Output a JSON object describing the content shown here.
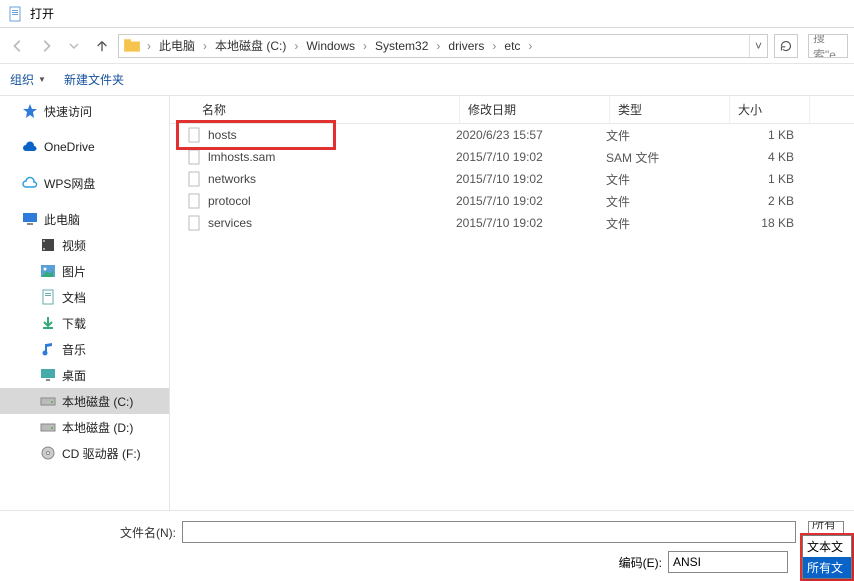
{
  "window": {
    "title": "打开"
  },
  "nav": {
    "breadcrumb": [
      "此电脑",
      "本地磁盘 (C:)",
      "Windows",
      "System32",
      "drivers",
      "etc"
    ],
    "search_placeholder": "搜索\"e"
  },
  "toolbar": {
    "organize": "组织",
    "new_folder": "新建文件夹"
  },
  "sidebar": {
    "items": [
      {
        "id": "quick-access",
        "label": "快速访问",
        "icon": "star",
        "color": "#2f7bd9"
      },
      {
        "id": "onedrive",
        "label": "OneDrive",
        "icon": "cloud",
        "color": "#0a64c8"
      },
      {
        "id": "wps-cloud",
        "label": "WPS网盘",
        "icon": "cloud-outline",
        "color": "#2f9fe0"
      },
      {
        "id": "this-pc",
        "label": "此电脑",
        "icon": "monitor",
        "color": "#2f7bd9"
      },
      {
        "id": "videos",
        "label": "视频",
        "icon": "film",
        "child": true
      },
      {
        "id": "pictures",
        "label": "图片",
        "icon": "picture",
        "child": true
      },
      {
        "id": "documents",
        "label": "文档",
        "icon": "doc",
        "child": true
      },
      {
        "id": "downloads",
        "label": "下载",
        "icon": "download",
        "child": true
      },
      {
        "id": "music",
        "label": "音乐",
        "icon": "music",
        "child": true
      },
      {
        "id": "desktop",
        "label": "桌面",
        "icon": "desktop",
        "child": true
      },
      {
        "id": "disk-c",
        "label": "本地磁盘 (C:)",
        "icon": "disk",
        "child": true,
        "selected": true
      },
      {
        "id": "disk-d",
        "label": "本地磁盘 (D:)",
        "icon": "disk",
        "child": true
      },
      {
        "id": "cd-f",
        "label": "CD 驱动器 (F:)",
        "icon": "cd",
        "child": true
      }
    ]
  },
  "columns": {
    "name": "名称",
    "date": "修改日期",
    "type": "类型",
    "size": "大小"
  },
  "files": [
    {
      "name": "hosts",
      "date": "2020/6/23 15:57",
      "type": "文件",
      "size": "1 KB",
      "highlight": true
    },
    {
      "name": "lmhosts.sam",
      "date": "2015/7/10 19:02",
      "type": "SAM 文件",
      "size": "4 KB"
    },
    {
      "name": "networks",
      "date": "2015/7/10 19:02",
      "type": "文件",
      "size": "1 KB"
    },
    {
      "name": "protocol",
      "date": "2015/7/10 19:02",
      "type": "文件",
      "size": "2 KB"
    },
    {
      "name": "services",
      "date": "2015/7/10 19:02",
      "type": "文件",
      "size": "18 KB"
    }
  ],
  "bottom": {
    "filename_label": "文件名(N):",
    "encoding_label": "编码(E):",
    "encoding_value": "ANSI",
    "filter_selected": "所有文",
    "filter_options": [
      "文本文",
      "所有文"
    ]
  }
}
